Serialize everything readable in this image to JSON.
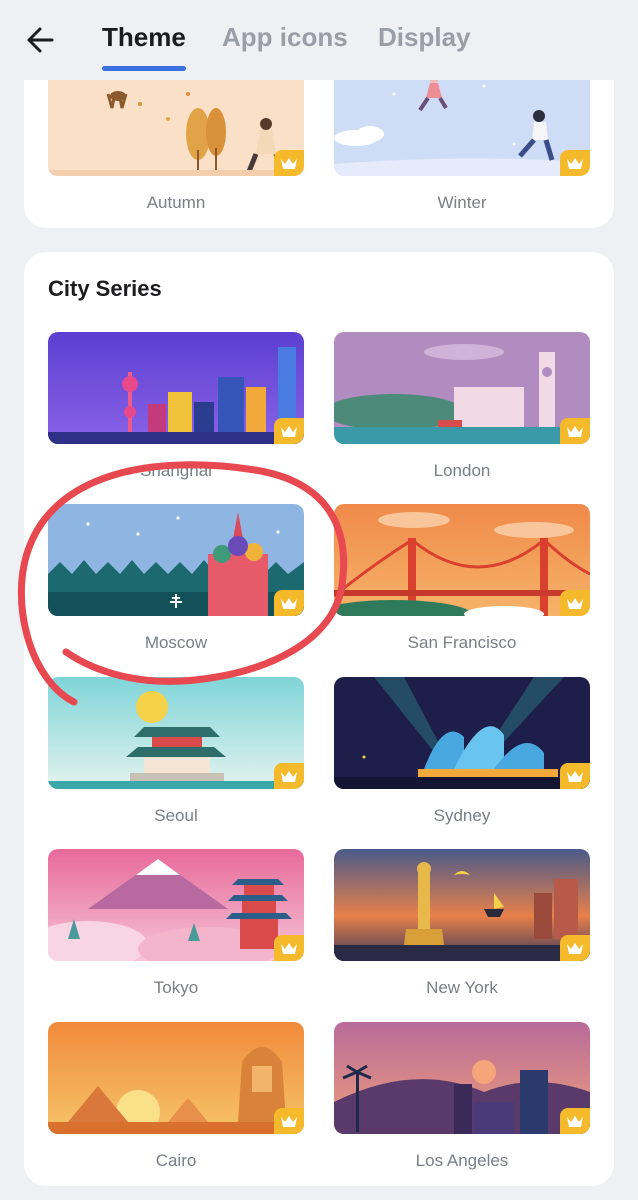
{
  "header": {
    "tabs": [
      {
        "label": "Theme",
        "active": true
      },
      {
        "label": "App icons",
        "active": false
      },
      {
        "label": "Display",
        "active": false
      }
    ]
  },
  "season_series": {
    "items": [
      {
        "label": "Autumn",
        "premium": true
      },
      {
        "label": "Winter",
        "premium": true
      }
    ]
  },
  "city_series": {
    "title": "City Series",
    "items": [
      {
        "label": "Shanghai",
        "premium": true
      },
      {
        "label": "London",
        "premium": true
      },
      {
        "label": "Moscow",
        "premium": true
      },
      {
        "label": "San Francisco",
        "premium": true
      },
      {
        "label": "Seoul",
        "premium": true
      },
      {
        "label": "Sydney",
        "premium": true
      },
      {
        "label": "Tokyo",
        "premium": true
      },
      {
        "label": "New York",
        "premium": true
      },
      {
        "label": "Cairo",
        "premium": true
      },
      {
        "label": "Los Angeles",
        "premium": true
      }
    ]
  },
  "colors": {
    "accent": "#3c6fe0",
    "crown_badge": "#f5b92c",
    "annotation": "#e8484f"
  },
  "icons": {
    "back": "arrow-left-icon",
    "premium": "crown-icon"
  }
}
